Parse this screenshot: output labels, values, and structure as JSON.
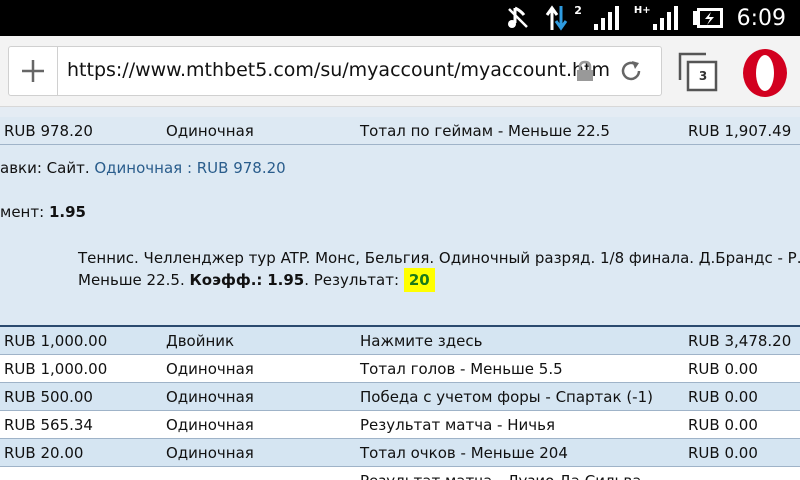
{
  "status_bar": {
    "time": "6:09",
    "signal_badge_left": "2",
    "signal_badge_right": "H+"
  },
  "browser": {
    "url": "https://www.mthbet5.com/su/myaccount/myaccount.htm",
    "tab_count": "3"
  },
  "bets_top": {
    "stake": "RUB 978.20",
    "type": "Одиночная",
    "selection": "Тотал по геймам - Меньше 22.5",
    "returns": "RUB 1,907.49"
  },
  "details": {
    "line1_prefix": "авки: Сайт.",
    "line1_link": "Одиночная : RUB 978.20",
    "line2_prefix": "мент:",
    "line2_value": "1.95",
    "event_text": "Теннис. Челленджер тур ATP. Монс, Бельгия. Одиночный разряд. 1/8 финала. Д.Брандс - Р.Албот.",
    "market_text": "Меньше 22.5.",
    "odds_label": "Коэфф.:",
    "odds_value": "1.95",
    "result_label": ". Результат:",
    "result_value": "20"
  },
  "bets": [
    {
      "stake": "RUB 1,000.00",
      "type": "Двойник",
      "selection": "Нажмите здесь",
      "returns": "RUB 3,478.20"
    },
    {
      "stake": "RUB 1,000.00",
      "type": "Одиночная",
      "selection": "Тотал голов - Меньше 5.5",
      "returns": "RUB 0.00"
    },
    {
      "stake": "RUB 500.00",
      "type": "Одиночная",
      "selection": "Победа с учетом форы - Спартак (-1)",
      "returns": "RUB 0.00"
    },
    {
      "stake": "RUB 565.34",
      "type": "Одиночная",
      "selection": "Результат матча - Ничья",
      "returns": "RUB 0.00"
    },
    {
      "stake": "RUB 20.00",
      "type": "Одиночная",
      "selection": "Тотал очков - Меньше 204",
      "returns": "RUB 0.00"
    },
    {
      "stake": "",
      "type": "",
      "selection": "Результат матча - Лузио Да Сильва",
      "returns": ""
    }
  ],
  "colors": {
    "row_blue": "#dde9f3",
    "highlight": "#ffff00",
    "result_green": "#1a7a1a",
    "link": "#2a5d8c"
  }
}
